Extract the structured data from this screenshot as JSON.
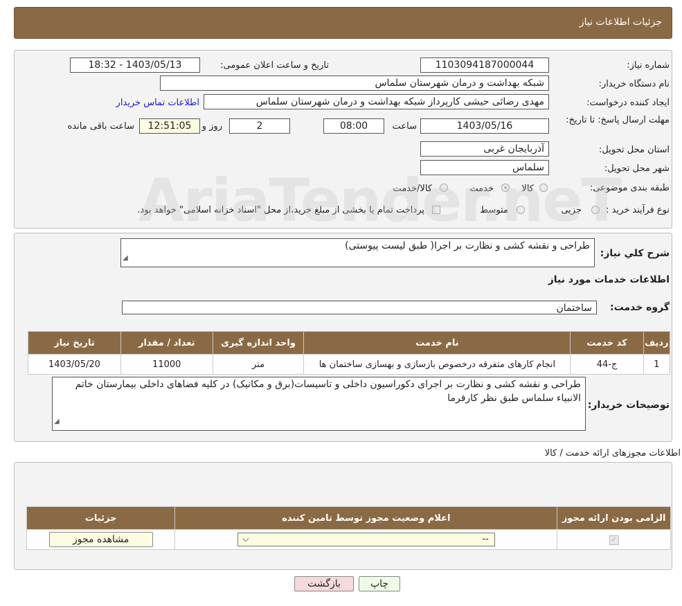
{
  "header": {
    "title": "جزئیات اطلاعات نیاز"
  },
  "form": {
    "need_number_label": "شماره نیاز:",
    "need_number": "1103094187000044",
    "announce_label": "تاریخ و ساعت اعلان عمومی:",
    "announce_value": "1403/05/13 - 18:32",
    "buyer_label": "نام دستگاه خریدار:",
    "buyer_value": "شبکه بهداشت و درمان  شهرستان سلماس",
    "creator_label": "ایجاد کننده درخواست:",
    "creator_value": "مهدی رضائی حیشی کارپرداز شبکه بهداشت و درمان  شهرستان سلماس",
    "contact_link": "اطلاعات تماس خریدار",
    "deadline_label": "مهلت ارسال پاسخ: تا تاریخ:",
    "deadline_date": "1403/05/16",
    "time_label": "ساعت",
    "deadline_time": "08:00",
    "days_value": "2",
    "days_label": "روز و",
    "remaining_time": "12:51:05",
    "remaining_label": "ساعت باقی مانده",
    "province_label": "استان محل تحویل:",
    "province_value": "آذربایجان غربی",
    "city_label": "شهر محل تحویل:",
    "city_value": "سلماس",
    "category_label": "طبقه بندی موضوعی:",
    "category_options": [
      "کالا",
      "خدمت",
      "کالا/خدمت"
    ],
    "process_label": "نوع فرآیند خرید :",
    "process_options": [
      "جزیی",
      "متوسط"
    ],
    "process_note": "پرداخت تمام یا بخشی از مبلغ خرید،از محل \"اسناد خزانه اسلامی\" خواهد بود."
  },
  "watermark": "AriaTender.neT",
  "summary": {
    "label": "شرح کلي نياز:",
    "value": "طراحی  و نقشه کشی و نظارت بر اجرا( طبق لیست پیوستی)",
    "services_title": "اطلاعات خدمات مورد نیاز",
    "group_label": "گروه خدمت:",
    "group_value": "ساختمان"
  },
  "services_table": {
    "headers": [
      "ردیف",
      "کد خدمت",
      "نام خدمت",
      "واحد اندازه گیری",
      "تعداد / مقدار",
      "تاریخ نیاز"
    ],
    "rows": [
      [
        "1",
        "ج-44",
        "انجام کارهای متفرقه درخصوص بازسازی و بهسازی ساختمان ها",
        "متر",
        "11000",
        "1403/05/20"
      ]
    ]
  },
  "buyer_notes": {
    "label": "توضیحات خریدار:",
    "value": "طراحی  و نقشه کشی و نظارت بر اجرای دکوراسیون داخلی و تاسیسات(برق و مکانیک) در کلیه فضاهای داخلی بیمارستان خاتم الانبیاء سلماس طبق نظر کارفرما"
  },
  "permits": {
    "title": "اطلاعات مجوزهای ارائه خدمت / کالا",
    "headers": [
      "الزامی بودن ارائه مجوز",
      "اعلام وضعیت مجوز توسط تامین کننده",
      "جزئیات"
    ],
    "select_value": "--",
    "view_button": "مشاهده مجوز"
  },
  "buttons": {
    "print": "چاپ",
    "back": "بازگشت"
  },
  "colors": {
    "header_bg": "#8a6a44",
    "back_btn": "#f6d9dc",
    "print_btn": "#eefbe6",
    "view_btn": "#fdfbe0"
  }
}
